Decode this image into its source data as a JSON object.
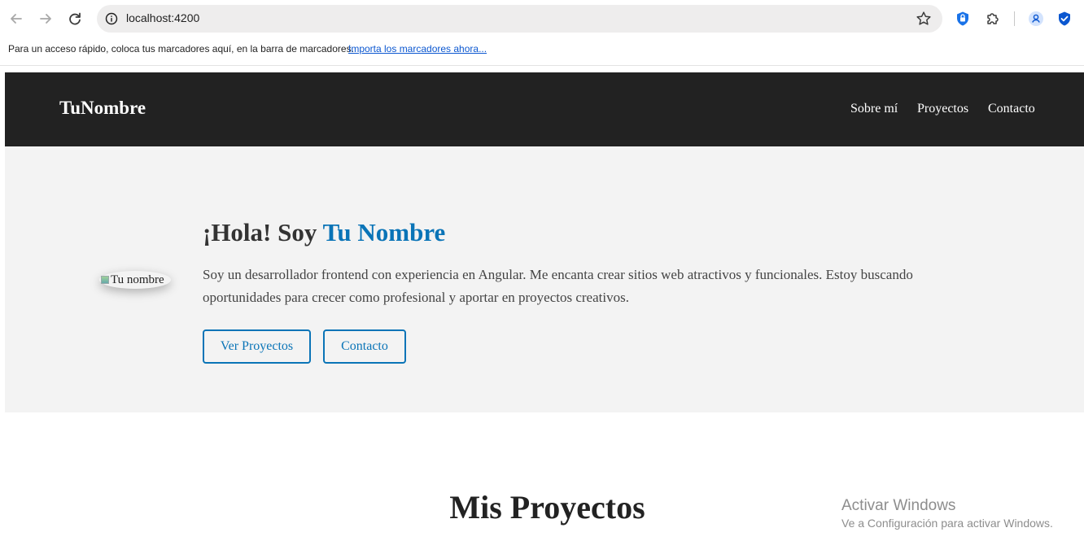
{
  "browser": {
    "url": "localhost:4200",
    "bookmarks_bar": {
      "message": "Para un acceso rápido, coloca tus marcadores aquí, en la barra de marcadores.",
      "import_link": "Importa los marcadores ahora..."
    },
    "icons": [
      "back-arrow-icon",
      "forward-arrow-icon",
      "reload-icon",
      "site-info-icon",
      "bookmark-star-icon",
      "shield-extension-icon",
      "extensions-puzzle-icon",
      "profile-icon",
      "security-shield-icon"
    ],
    "accent_color": "#0b57d0"
  },
  "site": {
    "header": {
      "logo": "TuNombre",
      "nav": [
        "Sobre mí",
        "Proyectos",
        "Contacto"
      ]
    },
    "hero": {
      "image_alt": "Tu nombre",
      "title_prefix": "¡Hola! Soy ",
      "title_highlight": "Tu Nombre",
      "description": "Soy un desarrollador frontend con experiencia en Angular. Me encanta crear sitios web atractivos y funcionales. Estoy buscando oportunidades para crecer como profesional y aportar en proyectos creativos.",
      "buttons": [
        "Ver Proyectos",
        "Contacto"
      ]
    },
    "projects": {
      "title": "Mis Proyectos"
    },
    "colors": {
      "header_bg": "#222222",
      "hero_bg": "#f3f3f3",
      "accent": "#0a74b7"
    }
  },
  "os_watermark": {
    "title": "Activar Windows",
    "subtitle": "Ve a Configuración para activar Windows."
  }
}
